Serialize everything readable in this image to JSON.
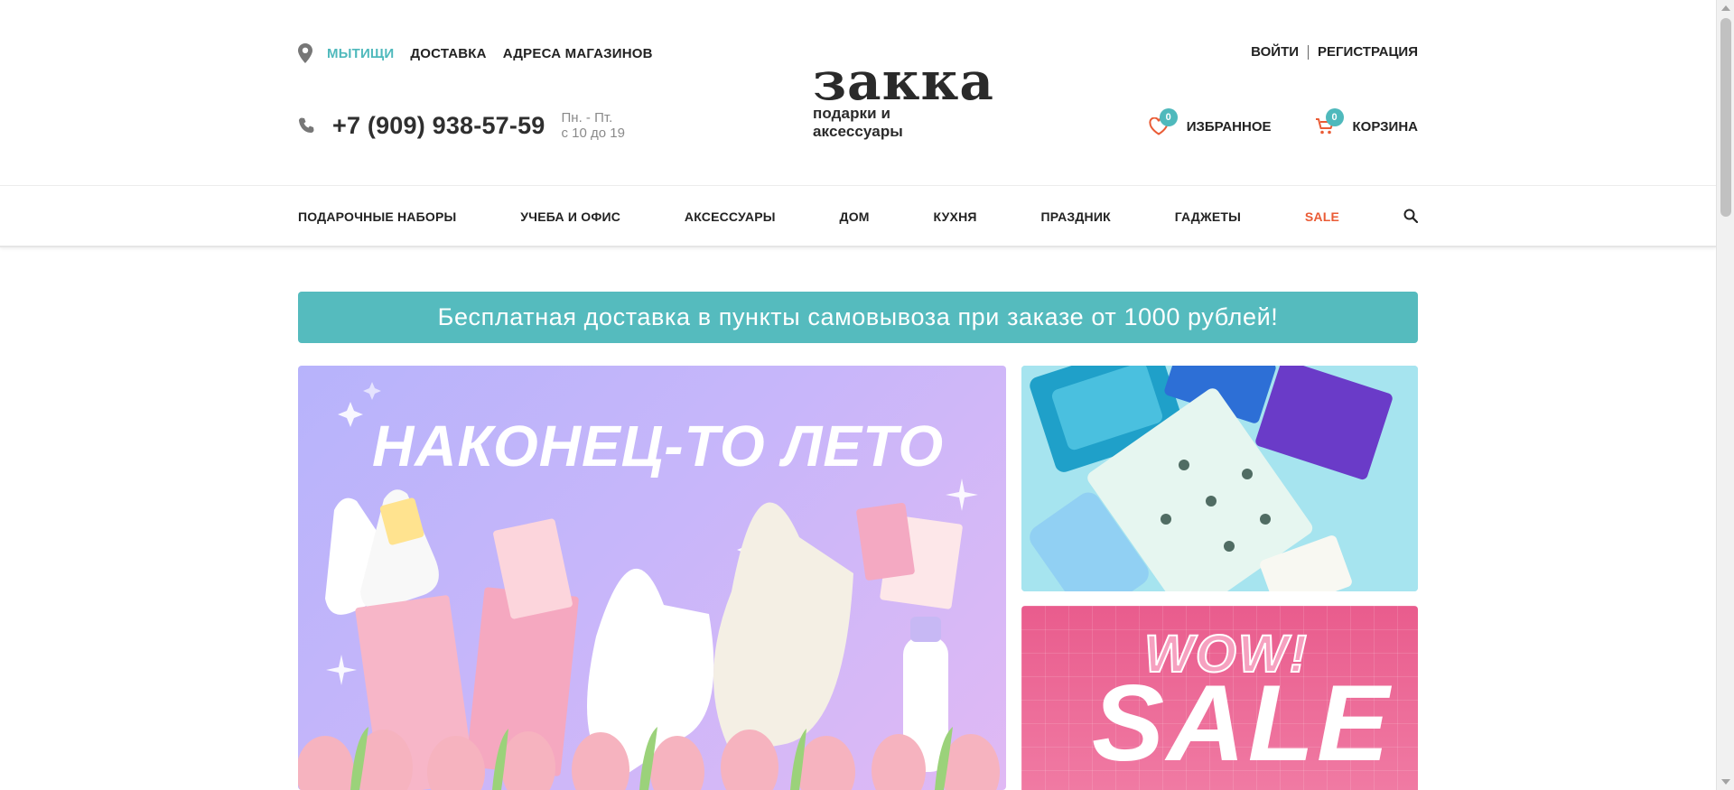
{
  "location": {
    "city": "МЫТИЩИ",
    "links": [
      "ДОСТАВКА",
      "АДРЕСА МАГАЗИНОВ"
    ]
  },
  "contact": {
    "phone": "+7 (909) 938-57-59",
    "hours_days": "Пн. - Пт.",
    "hours_time": "с 10 до 19"
  },
  "logo": {
    "name": "закка",
    "tagline": "подарки и аксессуары"
  },
  "auth": {
    "login": "ВОЙТИ",
    "register": "РЕГИСТРАЦИЯ"
  },
  "user_actions": {
    "favorites_label": "ИЗБРАННОЕ",
    "favorites_count": "0",
    "cart_label": "КОРЗИНА",
    "cart_count": "0"
  },
  "nav": {
    "items": [
      "ПОДАРОЧНЫЕ НАБОРЫ",
      "УЧЕБА И ОФИС",
      "АКСЕССУАРЫ",
      "ДОМ",
      "КУХНЯ",
      "ПРАЗДНИК",
      "ГАДЖЕТЫ"
    ],
    "sale": "SALE"
  },
  "promo": {
    "text": "Бесплатная доставка в пункты самовывоза при заказе от 1000 рублей!"
  },
  "banners": {
    "main_title": "НАКОНЕЦ-ТО ЛЕТО",
    "sale_wow": "WOW!",
    "sale_text": "SALE"
  },
  "colors": {
    "accent": "#4fb9bc",
    "promo_bg": "#55bbbe",
    "sale": "#ea5b35"
  },
  "icons": [
    "map-pin-icon",
    "phone-icon",
    "heart-icon",
    "cart-icon",
    "search-icon"
  ]
}
